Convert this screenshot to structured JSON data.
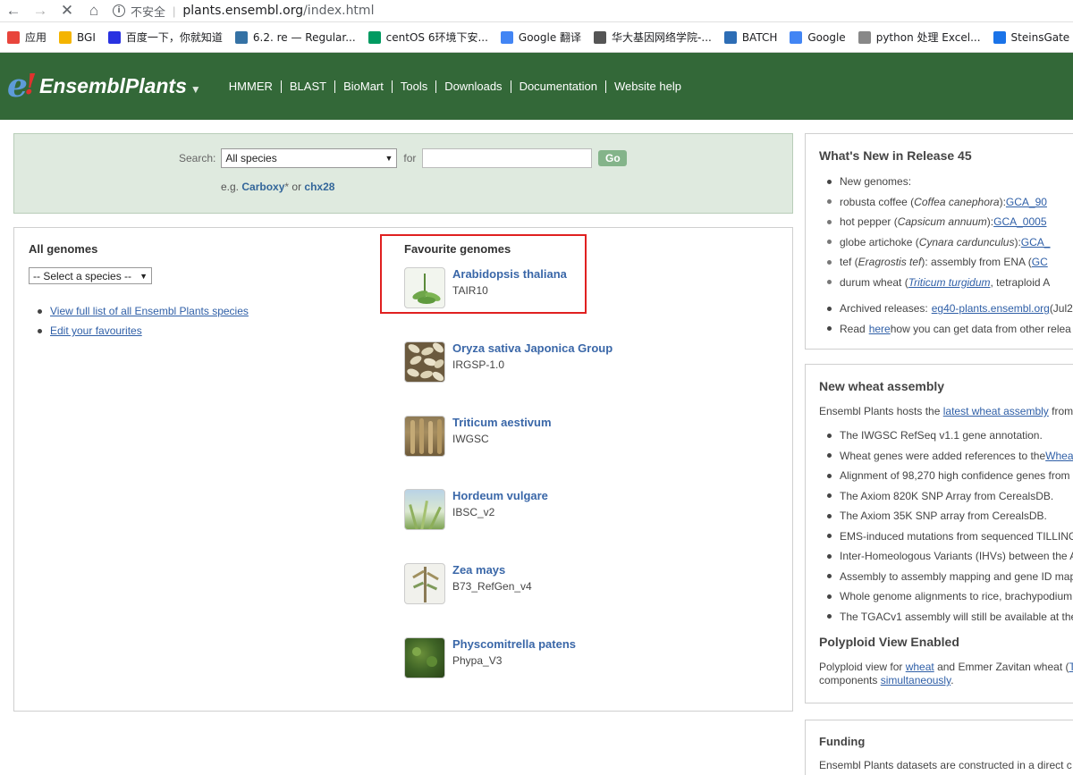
{
  "browser": {
    "insecure_label": "不安全",
    "url_host": "plants.ensembl.org",
    "url_path": "/index.html",
    "bookmarks": [
      {
        "label": "应用",
        "color": "#e8453c"
      },
      {
        "label": "BGI",
        "color": "#f4b400"
      },
      {
        "label": "百度一下，你就知道",
        "color": "#2932e1"
      },
      {
        "label": "6.2. re — Regular...",
        "color": "#3572a5"
      },
      {
        "label": "centOS 6环境下安...",
        "color": "#009a61"
      },
      {
        "label": "Google 翻译",
        "color": "#4285f4"
      },
      {
        "label": "华大基因网络学院-...",
        "color": "#555555"
      },
      {
        "label": "BATCH",
        "color": "#2d6db5"
      },
      {
        "label": "Google",
        "color": "#4285f4"
      },
      {
        "label": "python 处理 Excel...",
        "color": "#888888"
      },
      {
        "label": "SteinsGate【...",
        "color": "#1a73e8"
      }
    ]
  },
  "header": {
    "logo_text": "EnsemblPlants",
    "nav": [
      "HMMER",
      "BLAST",
      "BioMart",
      "Tools",
      "Downloads",
      "Documentation",
      "Website help"
    ]
  },
  "search": {
    "label": "Search:",
    "species_value": "All species",
    "for_label": "for",
    "go_label": "Go",
    "eg_prefix": "e.g.",
    "eg_link1": "Carboxy",
    "eg_star": "*",
    "eg_or": "or",
    "eg_link2": "chx28"
  },
  "all_genomes": {
    "heading": "All genomes",
    "select_value": "-- Select a species --",
    "links": [
      "View full list of all Ensembl Plants species",
      "Edit your favourites"
    ]
  },
  "favourites": {
    "heading": "Favourite genomes",
    "items": [
      {
        "name": "Arabidopsis thaliana",
        "assembly": "TAIR10"
      },
      {
        "name": "Oryza sativa Japonica Group",
        "assembly": "IRGSP-1.0"
      },
      {
        "name": "Triticum aestivum",
        "assembly": "IWGSC"
      },
      {
        "name": "Hordeum vulgare",
        "assembly": "IBSC_v2"
      },
      {
        "name": "Zea mays",
        "assembly": "B73_RefGen_v4"
      },
      {
        "name": "Physcomitrella patens",
        "assembly": "Phypa_V3"
      }
    ]
  },
  "whats_new": {
    "heading": "What's New in Release 45",
    "new_genomes": "New genomes:",
    "genomes": [
      {
        "pre": "robusta coffee (",
        "latin": "Coffea canephora",
        "post": "): ",
        "link": "GCA_90"
      },
      {
        "pre": "hot pepper (",
        "latin": "Capsicum annuum",
        "post": "): ",
        "link": "GCA_0005"
      },
      {
        "pre": "globe artichoke (",
        "latin": "Cynara cardunculus",
        "post": "): ",
        "link": "GCA_"
      },
      {
        "pre": "tef (",
        "latin": "Eragrostis tef",
        "post": "): assembly from ENA (",
        "link": "GC"
      },
      {
        "pre": "durum wheat (",
        "latin": "Triticum turgidum",
        "post": ", tetraploid A",
        "link": ""
      }
    ],
    "archived_pre": "Archived releases:",
    "archived_link": "eg40-plants.ensembl.org",
    "archived_post": " (Jul2",
    "read_pre": "Read",
    "read_link": "here",
    "read_post": " how you can get data from other relea"
  },
  "wheat": {
    "heading": "New wheat assembly",
    "intro_pre": "Ensembl Plants hosts the ",
    "intro_link": "latest wheat assembly",
    "intro_post": " from",
    "items": [
      "The IWGSC RefSeq v1.1 gene annotation.",
      "Wheat genes were added references to the ",
      "Alignment of 98,270 high confidence genes from",
      "The Axiom 820K SNP Array from CerealsDB.",
      "The Axiom 35K SNP array from CerealsDB.",
      "EMS-induced mutations from sequenced TILLING",
      "Inter-Homeologous Variants (IHVs) between the A",
      "Assembly to assembly mapping and gene ID map",
      "Whole genome alignments to rice, brachypodium",
      "The TGACv1 assembly will still be available at the"
    ],
    "item2_link": "Whea",
    "polyploid_heading": "Polyploid View Enabled",
    "poly_pre": "Polyploid view for ",
    "poly_link1": "wheat",
    "poly_mid": " and Emmer Zavitan wheat (",
    "poly_link2": "T",
    "poly_line2_pre": "components ",
    "poly_link3": "simultaneously",
    "poly_line2_post": "."
  },
  "funding": {
    "heading": "Funding",
    "text": "Ensembl Plants datasets are constructed in a direct c"
  }
}
